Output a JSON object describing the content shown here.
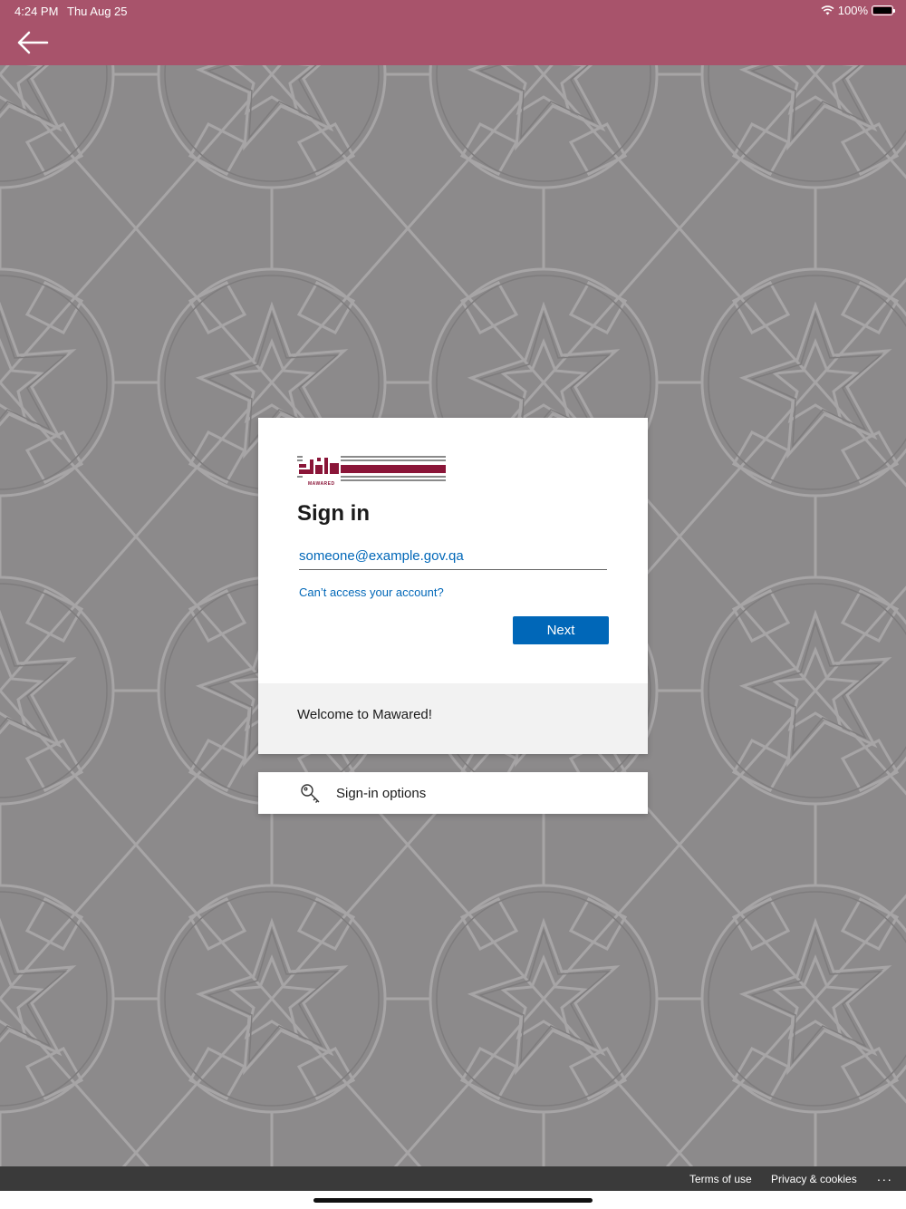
{
  "status_bar": {
    "time": "4:24 PM",
    "date": "Thu Aug 25",
    "battery": "100%"
  },
  "header": {
    "background_color": "#a8536b"
  },
  "login": {
    "logo_caption": "MAWARED",
    "title": "Sign in",
    "email_placeholder": "someone@example.gov.qa",
    "cant_access": "Can’t access your account?",
    "next_label": "Next",
    "welcome": "Welcome to Mawared!",
    "accent_color": "#0067b8"
  },
  "signin_options": {
    "label": "Sign-in options"
  },
  "footer": {
    "terms": "Terms of use",
    "privacy": "Privacy & cookies",
    "more": "..."
  }
}
